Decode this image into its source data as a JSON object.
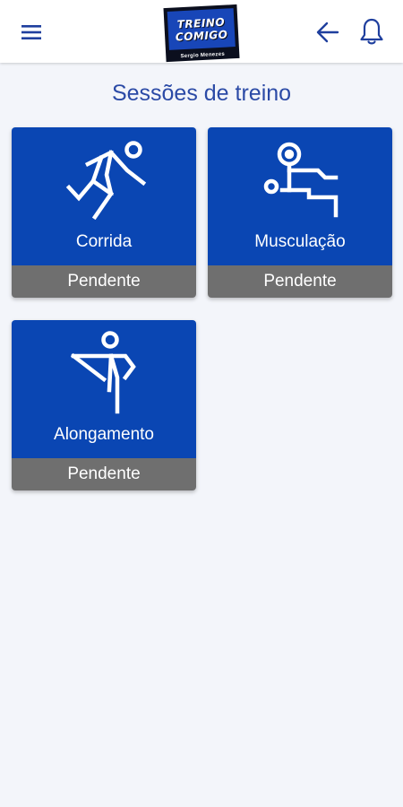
{
  "header": {
    "logo_line1": "TREINO",
    "logo_line2": "COMIGO",
    "logo_sub": "Sergio Menezes",
    "menu_icon": "hamburger-menu-icon",
    "back_icon": "arrow-left-icon",
    "notifications_icon": "bell-icon"
  },
  "page": {
    "title": "Sessões de treino"
  },
  "sessions": [
    {
      "label": "Corrida",
      "status": "Pendente",
      "icon": "running-person-icon"
    },
    {
      "label": "Musculação",
      "status": "Pendente",
      "icon": "weightlifting-bench-icon"
    },
    {
      "label": "Alongamento",
      "status": "Pendente",
      "icon": "stretching-person-icon"
    }
  ],
  "colors": {
    "accent": "#0a46b3",
    "title": "#2b4aa6",
    "status_bg": "#6f6f6f",
    "background": "#f3f5fa"
  }
}
